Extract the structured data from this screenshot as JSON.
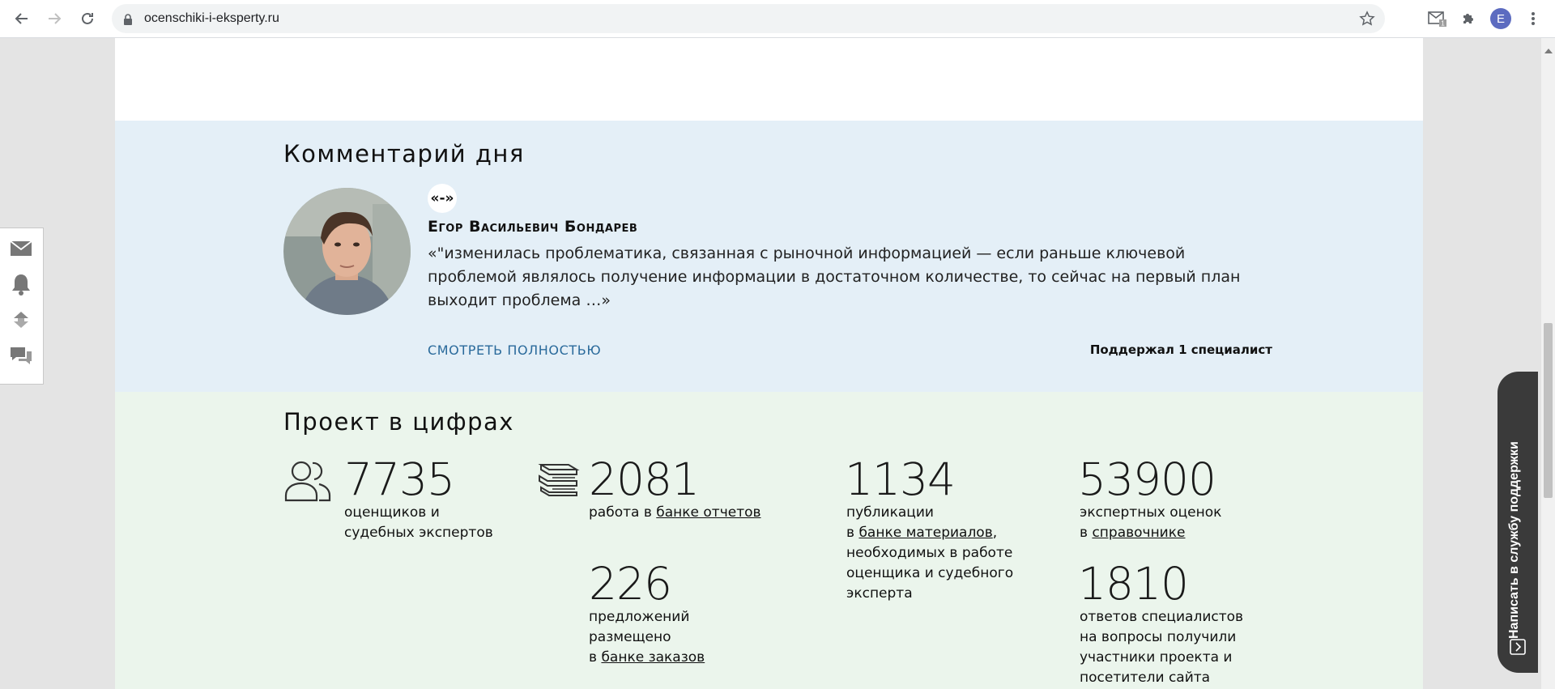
{
  "browser": {
    "url": "ocenschiki-i-eksperty.ru",
    "profile_initial": "E",
    "ext_badge": "1"
  },
  "comment": {
    "title": "Комментарий дня",
    "quote_symbol": "«-»",
    "author": "Егор Васильевич Бондарев",
    "text": "«\"изменилась проблематика, связанная с рыночной информацией — если раньше ключевой проблемой являлось получение информации в достаточном количестве, то сейчас на первый план выходит проблема …»",
    "more_label": "СМОТРЕТЬ ПОЛНОСТЬЮ",
    "support_count": "Поддержал 1 специалист"
  },
  "stats": {
    "title": "Проект в цифрах",
    "appraisers": {
      "number": "7735",
      "line1": "оценщиков и",
      "line2": "судебных экспертов"
    },
    "reports": {
      "number": "2081",
      "prefix": "работа в ",
      "link": "банке отчетов"
    },
    "offers": {
      "number": "226",
      "line1": "предложений",
      "line2": "размещено",
      "prefix": "в ",
      "link": "банке заказов"
    },
    "publications": {
      "number": "1134",
      "line1": "публикации",
      "prefix": "в ",
      "link": "банке материалов",
      "suffix": ",",
      "line3": "необходимых в работе",
      "line4": "оценщика и судебного",
      "line5": "эксперта"
    },
    "ratings": {
      "number": "53900",
      "line1": "экспертных оценок",
      "prefix": "в ",
      "link": "справочнике"
    },
    "answers": {
      "number": "1810",
      "line1": "ответов специалистов",
      "line2": "на вопросы получили",
      "line3": "участники проекта и",
      "line4": "посетители сайта"
    }
  },
  "support_tab": {
    "label": "Написать в службу поддержки"
  },
  "colors": {
    "comment_bg": "#e4eff7",
    "stats_bg": "#ebf5ec",
    "link": "#2a6a9b",
    "support_tab": "#3a3a3a"
  }
}
